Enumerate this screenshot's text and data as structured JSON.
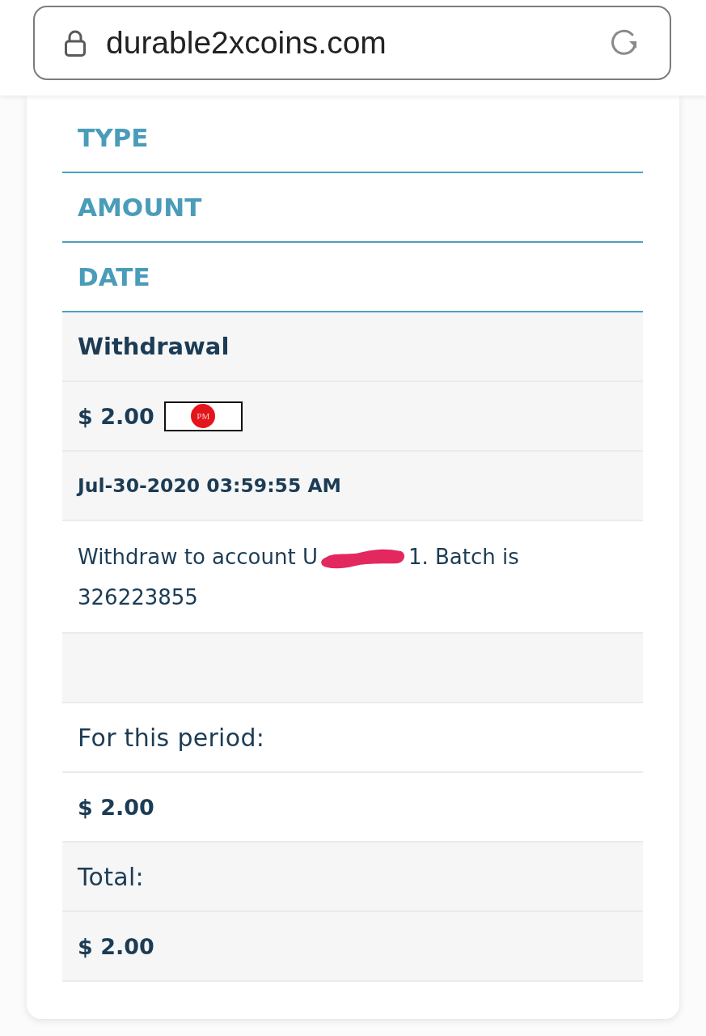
{
  "address_bar": {
    "url": "durable2xcoins.com"
  },
  "table": {
    "columns": [
      "TYPE",
      "AMOUNT",
      "DATE"
    ],
    "rows": [
      {
        "kind": "cells",
        "cells": [
          {
            "kind": "type",
            "text": "Withdrawal"
          },
          {
            "kind": "amount",
            "text": "$ 2.00",
            "badge": "PM"
          },
          {
            "kind": "date",
            "text": "Jul-30-2020 03:59:55 AM"
          }
        ]
      },
      {
        "kind": "cells",
        "cells": [
          {
            "kind": "description",
            "before_redaction": "Withdraw to account U",
            "after_redaction": "1. Batch is",
            "next_line": "326223855"
          }
        ]
      },
      {
        "kind": "spacer"
      },
      {
        "kind": "cells",
        "cells": [
          {
            "kind": "label",
            "text": "For this period:"
          },
          {
            "kind": "total",
            "text": "$ 2.00"
          }
        ]
      },
      {
        "kind": "cells",
        "cells": [
          {
            "kind": "label",
            "text": "Total:"
          },
          {
            "kind": "total",
            "text": "$ 2.00"
          }
        ]
      }
    ]
  }
}
